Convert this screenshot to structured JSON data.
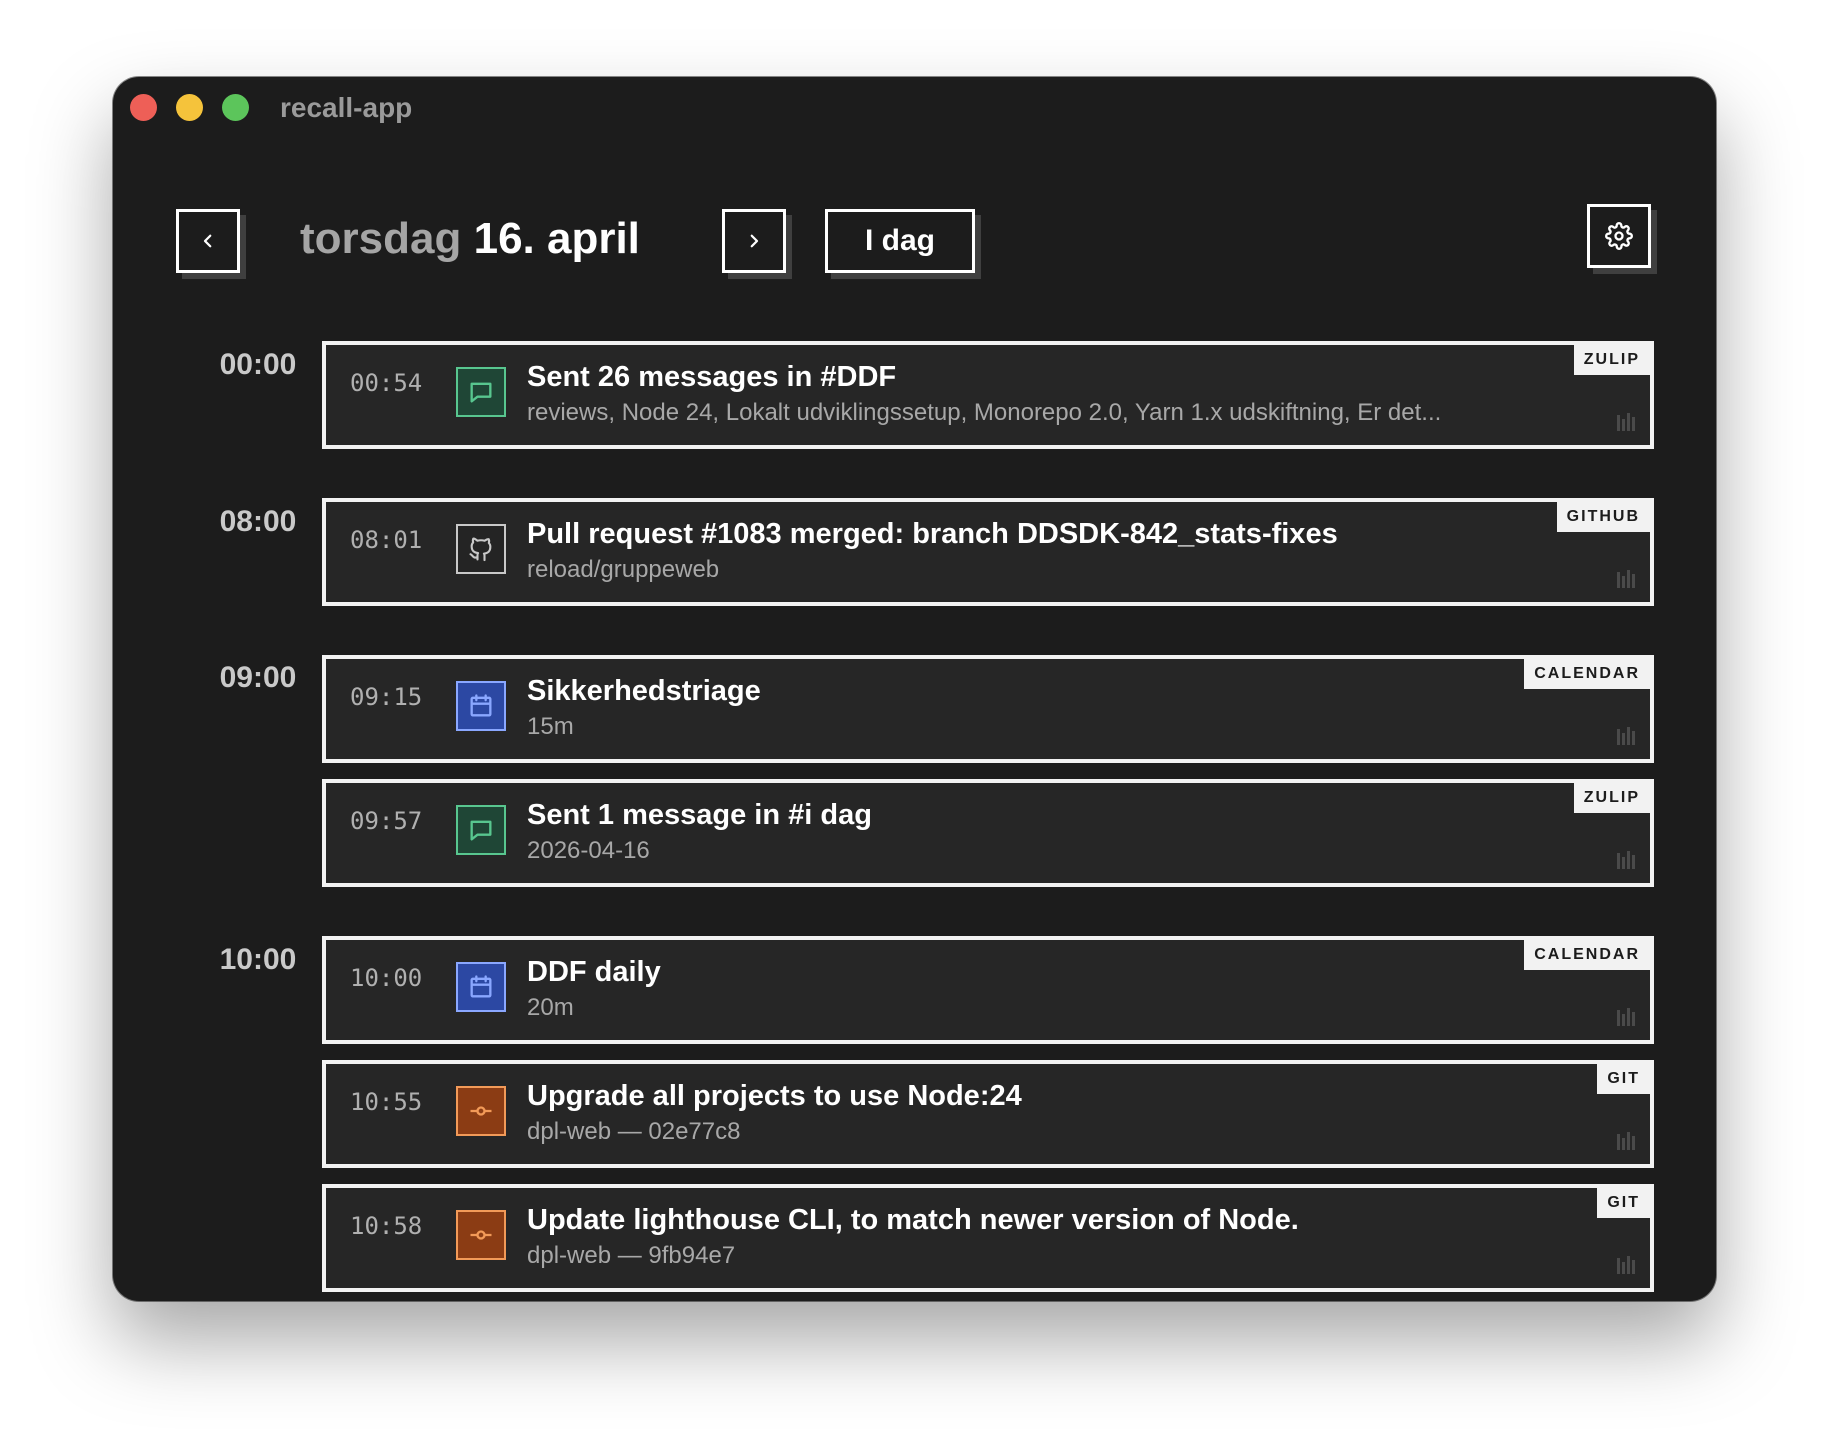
{
  "window": {
    "title": "recall-app"
  },
  "header": {
    "weekday": "torsdag",
    "date": "16. april",
    "today_label": "I dag"
  },
  "hours": [
    "00:00",
    "08:00",
    "09:00",
    "10:00"
  ],
  "events": [
    {
      "time": "00:54",
      "source": "ZULIP",
      "icon": "chat-icon",
      "title": "Sent 26 messages in #DDF",
      "subtitle": "reviews, Node 24, Lokalt udviklingssetup, Monorepo 2.0, Yarn 1.x udskiftning, Er det..."
    },
    {
      "time": "08:01",
      "source": "GITHUB",
      "icon": "github-icon",
      "title": "Pull request #1083 merged: branch DDSDK-842_stats-fixes",
      "subtitle": "reload/gruppeweb"
    },
    {
      "time": "09:15",
      "source": "CALENDAR",
      "icon": "calendar-icon",
      "title": "Sikkerhedstriage",
      "subtitle": "15m"
    },
    {
      "time": "09:57",
      "source": "ZULIP",
      "icon": "chat-icon",
      "title": "Sent 1 message in #i dag",
      "subtitle": "2026-04-16"
    },
    {
      "time": "10:00",
      "source": "CALENDAR",
      "icon": "calendar-icon",
      "title": "DDF daily",
      "subtitle": "20m"
    },
    {
      "time": "10:55",
      "source": "GIT",
      "icon": "git-commit-icon",
      "title": "Upgrade all projects to use Node:24",
      "subtitle": "dpl-web — 02e77c8"
    },
    {
      "time": "10:58",
      "source": "GIT",
      "icon": "git-commit-icon",
      "title": "Update lighthouse CLI, to match newer version of Node.",
      "subtitle": "dpl-web — 9fb94e7"
    }
  ],
  "colors": {
    "zulip": "#58c68f",
    "github": "#c8c8c8",
    "calendar": "#8aa7ff",
    "git": "#f29a58"
  }
}
